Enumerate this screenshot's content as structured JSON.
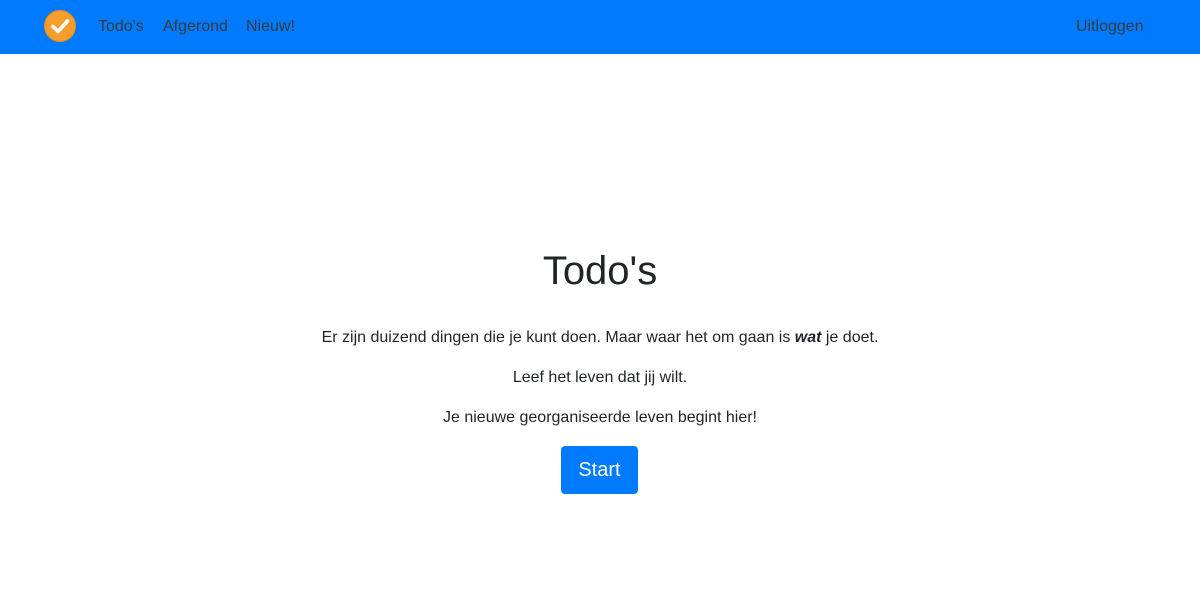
{
  "navbar": {
    "logo_icon": "check-circle-icon",
    "logo_color": "#f59e2e",
    "background_color": "#007bff",
    "links": [
      {
        "label": "Todo's"
      },
      {
        "label": "Afgerond"
      },
      {
        "label": "Nieuw!"
      }
    ],
    "logout_label": "Uitloggen"
  },
  "hero": {
    "title": "Todo's",
    "line1_before": "Er zijn duizend dingen die je kunt doen. Maar waar het om gaan is ",
    "line1_emphasis": "wat",
    "line1_after": " je doet.",
    "line2": "Leef het leven dat jij wilt.",
    "line3": "Je nieuwe georganiseerde leven begint hier!",
    "start_label": "Start",
    "button_color": "#007bff"
  }
}
